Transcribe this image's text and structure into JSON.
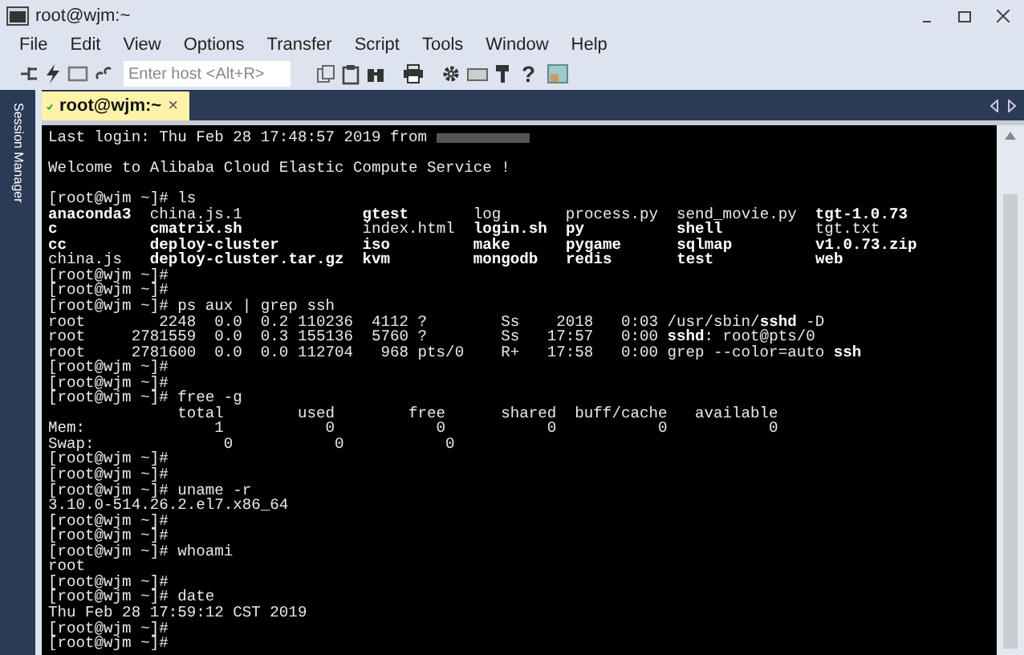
{
  "window": {
    "title": "root@wjm:~"
  },
  "menu": [
    {
      "label": "File"
    },
    {
      "label": "Edit"
    },
    {
      "label": "View"
    },
    {
      "label": "Options"
    },
    {
      "label": "Transfer"
    },
    {
      "label": "Script"
    },
    {
      "label": "Tools"
    },
    {
      "label": "Window"
    },
    {
      "label": "Help"
    }
  ],
  "toolbar": {
    "host_field": {
      "placeholder": "Enter host <Alt+R>"
    },
    "help_glyph": "?"
  },
  "sidebar": {
    "label": "Session Manager"
  },
  "tabs": [
    {
      "label": "root@wjm:~",
      "selected": true,
      "connected": true,
      "close_glyph": "×"
    }
  ],
  "terminal": {
    "lines": [
      {
        "kind": "redacted",
        "text": "Last login: Thu Feb 28 17:48:57 2019 from "
      },
      {
        "kind": "blank"
      },
      {
        "kind": "text",
        "text": "Welcome to Alibaba Cloud Elastic Compute Service !"
      },
      {
        "kind": "blank"
      },
      {
        "kind": "text",
        "text": "[root@wjm ~]# ls"
      },
      {
        "kind": "text",
        "text": "**anaconda3**  china.js.1             **gtest**       log       process.py  send_movie.py  **tgt-1.0.73**"
      },
      {
        "kind": "text",
        "text": "**c**          **cmatrix.sh**             index.html  **login.sh**  **py**          **shell**          tgt.txt"
      },
      {
        "kind": "text",
        "text": "**cc**         **deploy-cluster**         **iso**         **make**      **pygame**      **sqlmap**         **v1.0.73.zip**"
      },
      {
        "kind": "text",
        "text": "china.js   **deploy-cluster.tar.gz**  **kvm**         **mongodb**   **redis**       **test**           **web**"
      },
      {
        "kind": "text",
        "text": "[root@wjm ~]#"
      },
      {
        "kind": "text",
        "text": "[root@wjm ~]#"
      },
      {
        "kind": "text",
        "text": "[root@wjm ~]# ps aux | grep ssh"
      },
      {
        "kind": "text",
        "text": "root        2248  0.0  0.2 110236  4112 ?        Ss    2018   0:03 /usr/sbin/**sshd** -D"
      },
      {
        "kind": "text",
        "text": "root     2781559  0.0  0.3 155136  5760 ?        Ss   17:57   0:00 **sshd**: root@pts/0"
      },
      {
        "kind": "text",
        "text": "root     2781600  0.0  0.0 112704   968 pts/0    R+   17:58   0:00 grep --color=auto **ssh**"
      },
      {
        "kind": "text",
        "text": "[root@wjm ~]#"
      },
      {
        "kind": "text",
        "text": "[root@wjm ~]#"
      },
      {
        "kind": "text",
        "text": "[root@wjm ~]# free -g"
      },
      {
        "kind": "text",
        "text": "              total        used        free      shared  buff/cache   available"
      },
      {
        "kind": "text",
        "text": "Mem:              1           0           0           0           0           0"
      },
      {
        "kind": "text",
        "text": "Swap:              0           0           0"
      },
      {
        "kind": "text",
        "text": "[root@wjm ~]#"
      },
      {
        "kind": "text",
        "text": "[root@wjm ~]#"
      },
      {
        "kind": "text",
        "text": "[root@wjm ~]# uname -r"
      },
      {
        "kind": "text",
        "text": "3.10.0-514.26.2.el7.x86_64"
      },
      {
        "kind": "text",
        "text": "[root@wjm ~]#"
      },
      {
        "kind": "text",
        "text": "[root@wjm ~]#"
      },
      {
        "kind": "text",
        "text": "[root@wjm ~]# whoami"
      },
      {
        "kind": "text",
        "text": "root"
      },
      {
        "kind": "text",
        "text": "[root@wjm ~]#"
      },
      {
        "kind": "text",
        "text": "[root@wjm ~]# date"
      },
      {
        "kind": "text",
        "text": "Thu Feb 28 17:59:12 CST 2019"
      },
      {
        "kind": "text",
        "text": "[root@wjm ~]#"
      },
      {
        "kind": "text",
        "text": "[root@wjm ~]#"
      }
    ]
  }
}
